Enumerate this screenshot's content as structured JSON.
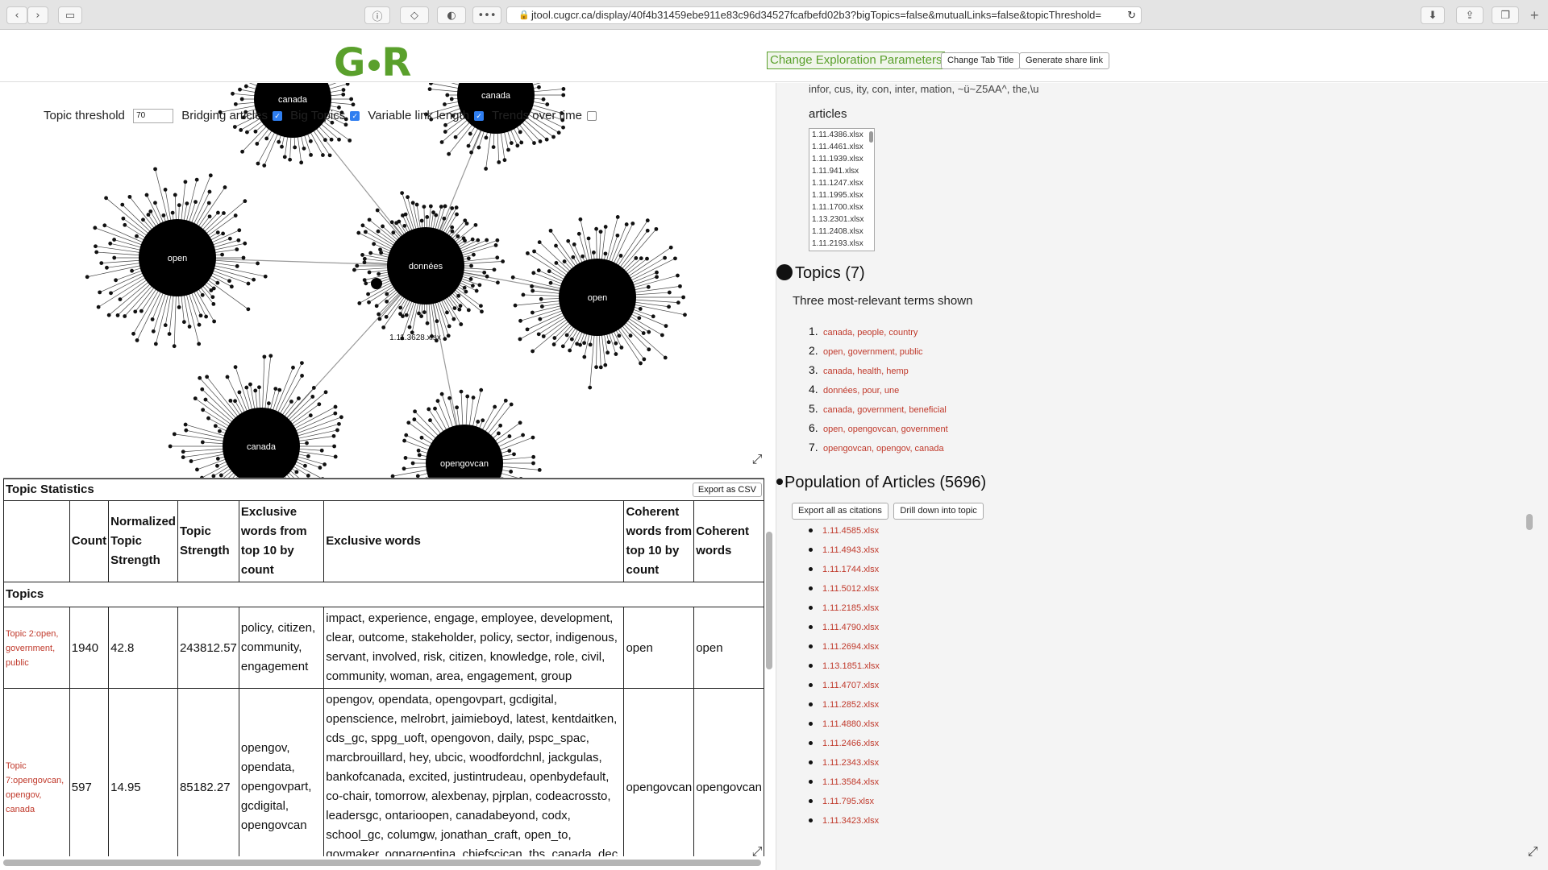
{
  "browser": {
    "url": "jtool.cugcr.ca/display/40f4b31459ebe911e83c96d34527fcafbefd02b3?bigTopics=false&mutualLinks=false&topicThreshold="
  },
  "header": {
    "logo_text": "G R",
    "change_params_label": "Change Exploration Parameters",
    "change_tab_label": "Change Tab Title",
    "share_label": "Generate share link"
  },
  "controls": {
    "threshold_label": "Topic threshold",
    "threshold_value": "70",
    "bridging_label": "Bridging articles",
    "big_topics_label": "Big Topics",
    "variable_link_label": "Variable link length",
    "trends_label": "Trends over time"
  },
  "graph": {
    "nodes": [
      {
        "label": "canada"
      },
      {
        "label": "canada"
      },
      {
        "label": "open"
      },
      {
        "label": "données"
      },
      {
        "label": "open"
      },
      {
        "label": "canada"
      },
      {
        "label": "opengovcan"
      }
    ],
    "hover_label": "1.11.3628.xlsx"
  },
  "stats": {
    "title": "Topic Statistics",
    "export_label": "Export as CSV",
    "headers": [
      "",
      "Count",
      "Normalized Topic Strength",
      "Topic Strength",
      "Exclusive words from top 10 by count",
      "Exclusive words",
      "Coherent words from top 10 by count",
      "Coherent words"
    ],
    "section_label": "Topics",
    "rows": [
      {
        "topic": "Topic 2:open, government, public",
        "count": "1940",
        "norm": "42.8",
        "strength": "243812.57",
        "excl_top": "policy, citizen, community, engagement",
        "excl": "impact, experience, engage, employee, development, clear, outcome, stakeholder, policy, sector, indigenous, servant, involved, risk, citizen, knowledge, role, civil, community, woman, area, engagement, group",
        "coh_top": "open",
        "coh": "open"
      },
      {
        "topic": "Topic 7:opengovcan, opengov, canada",
        "count": "597",
        "norm": "14.95",
        "strength": "85182.27",
        "excl_top": "opengov, opendata, opengovpart, gcdigital, opengovcan",
        "excl": "opengov, opendata, opengovpart, gcdigital, openscience, melrobrt, jaimieboyd, latest, kentdaitken, cds_gc, sppg_uoft, opengovon, daily, pspc_spac, marcbrouillard, hey, ubcic, woodfordchnl, jackgulas, bankofcanada, excited, justintrudeau, openbydefault, co-chair, tomorrow, alexbenay, pjrplan, codeacrossto, leadersgc, ontarioopen, canadabeyond, codx, school_gc, columgw, jonathan_craft, open_to, govmaker, ogpargentina, chiefscican, tbs_canada, dec, blog, hear,",
        "coh_top": "opengovcan",
        "coh": "opengovcan"
      }
    ]
  },
  "right": {
    "snippet": "infor, cus, ity, con, inter, mation, ~ü~Z5AA^, the,\\u",
    "articles_label": "articles",
    "article_select": [
      "1.11.4386.xlsx",
      "1.11.4461.xlsx",
      "1.11.1939.xlsx",
      "1.11.941.xlsx",
      "1.11.1247.xlsx",
      "1.11.1995.xlsx",
      "1.11.1700.xlsx",
      "1.13.2301.xlsx",
      "1.11.2408.xlsx",
      "1.11.2193.xlsx"
    ],
    "topics_heading": "Topics (7)",
    "topics_sub": "Three most-relevant terms shown",
    "topics": [
      {
        "num": "1.",
        "text": "canada, people, country"
      },
      {
        "num": "2.",
        "text": "open, government, public"
      },
      {
        "num": "3.",
        "text": "canada, health, hemp"
      },
      {
        "num": "4.",
        "text": "données, pour, une"
      },
      {
        "num": "5.",
        "text": "canada, government, beneficial"
      },
      {
        "num": "6.",
        "text": "open, opengovcan, government"
      },
      {
        "num": "7.",
        "text": "opengovcan, opengov, canada"
      }
    ],
    "population_heading": "Population of Articles (5696)",
    "export_citations_label": "Export all as citations",
    "drill_label": "Drill down into topic",
    "articles": [
      "1.11.4585.xlsx",
      "1.11.4943.xlsx",
      "1.11.1744.xlsx",
      "1.11.5012.xlsx",
      "1.11.2185.xlsx",
      "1.11.4790.xlsx",
      "1.11.2694.xlsx",
      "1.13.1851.xlsx",
      "1.11.4707.xlsx",
      "1.11.2852.xlsx",
      "1.11.4880.xlsx",
      "1.11.2466.xlsx",
      "1.11.2343.xlsx",
      "1.11.3584.xlsx",
      "1.11.795.xlsx",
      "1.11.3423.xlsx"
    ]
  }
}
